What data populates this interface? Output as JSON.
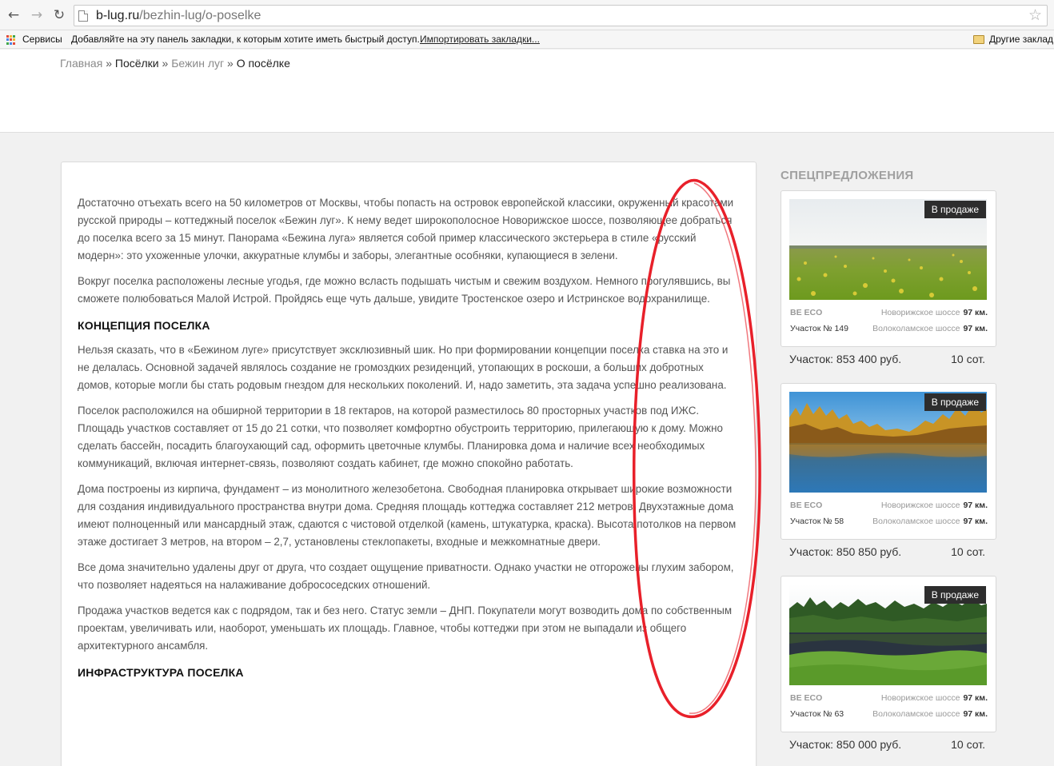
{
  "browser": {
    "url_domain": "b-lug.ru",
    "url_path": "/bezhin-lug/o-poselke",
    "back_glyph": "←",
    "forward_glyph": "→",
    "reload_glyph": "↻",
    "star_glyph": "☆"
  },
  "bookmarks_bar": {
    "apps_label": "Сервисы",
    "hint": "Добавляйте на эту панель закладки, к которым хотите иметь быстрый доступ.",
    "import_link": "Импортировать закладки...",
    "other_label": "Другие заклад"
  },
  "breadcrumb": {
    "items": [
      "Главная",
      "Посёлки",
      "Бежин луг",
      "О посёлке"
    ],
    "separator": "»"
  },
  "article": {
    "p1": "Достаточно отъехать всего на 50 километров от Москвы, чтобы попасть на островок европейской классики, окруженный красотами русской природы – коттеджный поселок «Бежин луг». К нему ведет широкополосное Новорижское шоссе, позволяющее добраться до поселка всего за 15 минут. Панорама «Бежина луга» является собой пример классического экстерьера в стиле «русский модерн»: это ухоженные улочки, аккуратные клумбы и заборы, элегантные особняки, купающиеся в зелени.",
    "p2": "Вокруг поселка расположены лесные угодья, где можно всласть подышать чистым и свежим воздухом. Немного прогулявшись, вы сможете полюбоваться Малой Истрой. Пройдясь еще чуть дальше, увидите Тростенское озеро и Истринское водохранилище.",
    "h1": "Концепция поселка",
    "p3": "Нельзя сказать, что в «Бежином луге» присутствует эксклюзивный шик. Но при формировании концепции поселка ставка на это и не делалась. Основной задачей являлось создание не громоздких резиденций, утопающих в роскоши, а больших добротных домов, которые могли бы стать родовым гнездом для нескольких поколений. И, надо заметить, эта задача успешно реализована.",
    "p4": "Поселок расположился на обширной территории в 18 гектаров, на которой разместилось 80 просторных участков под ИЖС. Площадь участков составляет от 15 до 21 сотки, что позволяет комфортно обустроить территорию, прилегающую к дому. Можно сделать бассейн, посадить благоухающий сад, оформить цветочные клумбы. Планировка дома и наличие всех необходимых коммуникаций, включая интернет-связь, позволяют создать кабинет, где можно спокойно работать.",
    "p5": "Дома построены из кирпича, фундамент – из монолитного железобетона. Свободная планировка открывает широкие возможности для создания индивидуального пространства внутри дома. Средняя площадь коттеджа составляет 212 метров. Двухэтажные дома имеют полноценный или мансардный этаж, сдаются с чистовой отделкой (камень, штукатурка, краска). Высота потолков на первом этаже достигает 3 метров, на втором – 2,7, установлены стеклопакеты, входные и межкомнатные двери.",
    "p6": "Все дома значительно удалены друг от друга, что создает ощущение приватности. Однако участки не отгорожены глухим забором, что позволяет надеяться на налаживание добрососедских отношений.",
    "p7": "Продажа участков ведется как с подрядом, так и без него. Статус земли – ДНП. Покупатели могут возводить дома по собственным проектам, увеличивать или, наоборот, уменьшать их площадь. Главное, чтобы коттеджи при этом не выпадали из общего архитектурного ансамбля.",
    "h2": "Инфраструктура поселка"
  },
  "sidebar": {
    "title": "СПЕЦПРЕДЛОЖЕНИЯ",
    "offers": [
      {
        "badge": "В продаже",
        "village": "BE ECO",
        "road1": "Новорижское шоссе",
        "dist1": "97 км.",
        "plot": "Участок № 149",
        "road2": "Волоколамское шоссе",
        "dist2": "97 км.",
        "price": "Участок: 853 400 руб.",
        "size": "10 сот.",
        "image": "dandelion-field"
      },
      {
        "badge": "В продаже",
        "village": "BE ECO",
        "road1": "Новорижское шоссе",
        "dist1": "97 км.",
        "plot": "Участок № 58",
        "road2": "Волоколамское шоссе",
        "dist2": "97 км.",
        "price": "Участок: 850 850 руб.",
        "size": "10 сот.",
        "image": "autumn-lake"
      },
      {
        "badge": "В продаже",
        "village": "BE ECO",
        "road1": "Новорижское шоссе",
        "dist1": "97 км.",
        "plot": "Участок № 63",
        "road2": "Волоколамское шоссе",
        "dist2": "97 км.",
        "price": "Участок: 850 000 руб.",
        "size": "10 сот.",
        "image": "forest-pond"
      }
    ]
  },
  "colors": {
    "annotation": "#e8202a",
    "breadcrumb_link": "#8a8a8a",
    "badge_bg": "#2d2d2d"
  },
  "annotation": {
    "shape": "hand-drawn-ellipse"
  }
}
